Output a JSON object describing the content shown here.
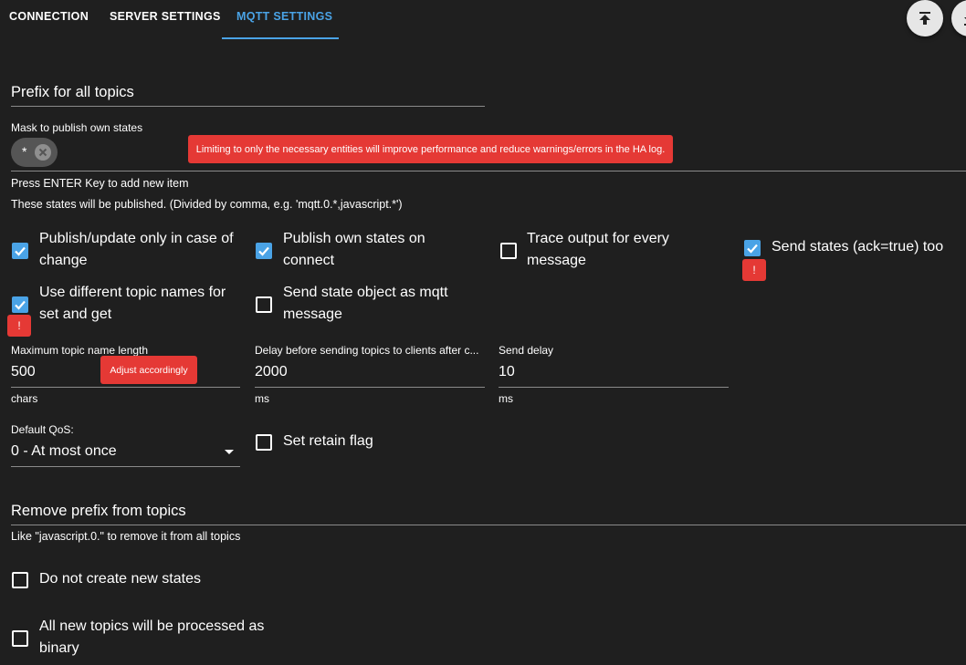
{
  "tabs": [
    {
      "label": "CONNECTION"
    },
    {
      "label": "SERVER SETTINGS"
    },
    {
      "label": "MQTT SETTINGS"
    }
  ],
  "actions": {
    "upload_icon": "upload-icon",
    "download_icon": "download-icon"
  },
  "prefix": {
    "label": "Prefix for all topics"
  },
  "mask": {
    "label": "Mask to publish own states",
    "chip_value": "*",
    "tooltip": "Limiting to only the necessary entities will improve performance and reduce warnings/errors in the HA log.",
    "helper1": "Press ENTER Key to add new item",
    "helper2": "These states will be published. (Divided by comma, e.g. 'mqtt.0.*,javascript.*')"
  },
  "checkboxes": {
    "publish_on_change": {
      "label": "Publish/update only in case of change",
      "checked": true
    },
    "publish_on_connect": {
      "label": "Publish own states on connect",
      "checked": true
    },
    "trace_output": {
      "label": "Trace output for every message",
      "checked": false
    },
    "send_ack": {
      "label": "Send states (ack=true) too",
      "checked": true,
      "badge": "!"
    },
    "different_topics": {
      "label": "Use different topic names for set and get",
      "checked": true,
      "badge": "!"
    },
    "send_state_object": {
      "label": "Send state object as mqtt message",
      "checked": false
    },
    "retain_flag": {
      "label": "Set retain flag",
      "checked": false
    },
    "no_new_states": {
      "label": "Do not create new states",
      "checked": false
    },
    "binary": {
      "label": "All new topics will be processed as binary",
      "checked": false
    }
  },
  "fields": {
    "max_topic_length": {
      "label": "Maximum topic name length",
      "value": "500",
      "unit": "chars",
      "tooltip": "Adjust accordingly"
    },
    "delay_before_sending": {
      "label": "Delay before sending topics to clients after c...",
      "value": "2000",
      "unit": "ms"
    },
    "send_delay": {
      "label": "Send delay",
      "value": "10",
      "unit": "ms"
    },
    "default_qos": {
      "label": "Default QoS:",
      "value": "0 - At most once"
    }
  },
  "remove_prefix": {
    "label": "Remove prefix from topics",
    "helper": "Like \"javascript.0.\" to remove it from all topics"
  },
  "colors": {
    "background": "#1f1f1f",
    "accent": "#4aa3e6",
    "error": "#e53935"
  }
}
